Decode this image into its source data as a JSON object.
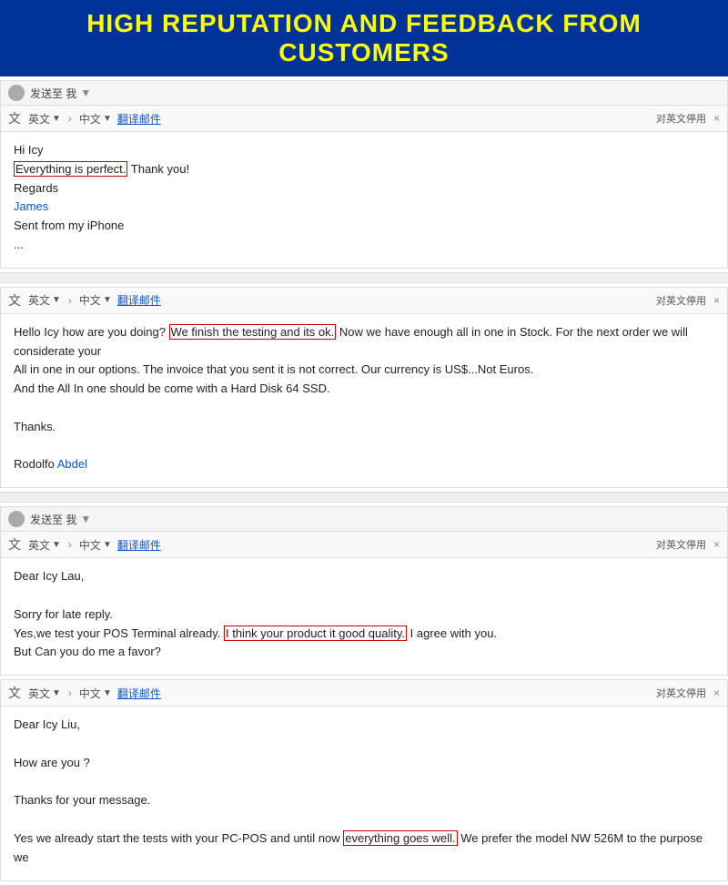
{
  "banner": {
    "text": "HIGH REPUTATION AND FEEDBACK FROM CUSTOMERS"
  },
  "email1": {
    "sendTo": "发送至 我",
    "translateBar": {
      "icon": "文",
      "langFrom": "英文",
      "langFromArrow": "▼",
      "langTo": "中文",
      "langToArrow": "▼",
      "translateLink": "翻译邮件",
      "rightLabel": "对英文停用",
      "closeX": "×"
    },
    "body": {
      "greeting": "Hi Icy",
      "line1_before": "",
      "line1_highlight": "Everything is perfect.",
      "line1_after": " Thank you!",
      "line2": "Regards",
      "name": "James",
      "line3": "Sent from my iPhone",
      "dots": "..."
    }
  },
  "email2": {
    "translateBar": {
      "icon": "文",
      "langFrom": "英文",
      "langFromArrow": "▼",
      "langTo": "中文",
      "langToArrow": "▼",
      "translateLink": "翻译邮件",
      "rightLabel": "对英文停用",
      "closeX": "×"
    },
    "body": {
      "line1_before": "Hello Icy how are you doing? ",
      "line1_highlight": "We finish the testing and its ok.",
      "line1_after": " Now we have enough all in one in Stock. For the next order we will considerate your",
      "line2": "All in one in our options. The invoice that you sent it is not correct. Our currency is US$...Not Euros.",
      "line3": "And the All In one should be come with a  Hard Disk 64 SSD.",
      "line4": "Thanks.",
      "signature": "Rodolfo Abdel"
    }
  },
  "email3": {
    "sendTo": "发送至 我",
    "translateBar": {
      "icon": "文",
      "langFrom": "英文",
      "langFromArrow": "▼",
      "langTo": "中文",
      "langToArrow": "▼",
      "translateLink": "翻译邮件",
      "rightLabel": "对英文停用",
      "closeX": "×"
    },
    "body": {
      "greeting": "Dear Icy Lau,",
      "line1": "Sorry for late reply.",
      "line2_before": "Yes,we test  your POS Terminal already. ",
      "line2_highlight": "I think your product it good quality.",
      "line2_after": " I agree with you.",
      "line3": "But Can you do me a favor?"
    }
  },
  "email4": {
    "translateBar": {
      "icon": "文",
      "langFrom": "英文",
      "langFromArrow": "▼",
      "langTo": "中文",
      "langToArrow": "▼",
      "translateLink": "翻译邮件",
      "rightLabel": "对英文停用",
      "closeX": "×"
    },
    "body": {
      "greeting": "Dear Icy Liu,",
      "line1": "How are you ?",
      "line2": "Thanks for your message.",
      "line3_before": "Yes we already start the tests with your PC-POS and until now ",
      "line3_highlight": "everything goes well.",
      "line3_after": " We prefer the model NW 526M to the purpose we"
    }
  }
}
